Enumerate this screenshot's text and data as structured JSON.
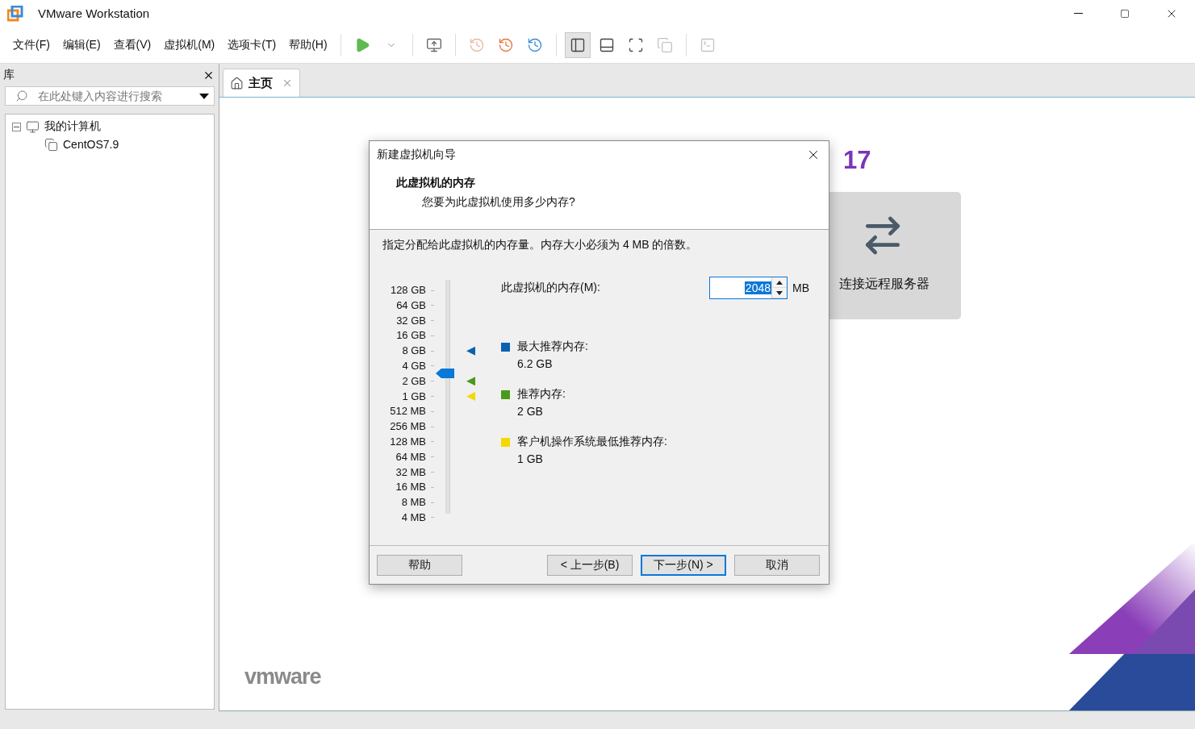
{
  "window": {
    "title": "VMware Workstation"
  },
  "menu": [
    "文件(F)",
    "编辑(E)",
    "查看(V)",
    "虚拟机(M)",
    "选项卡(T)",
    "帮助(H)"
  ],
  "toolbar": [
    {
      "kind": "play",
      "disabled": false,
      "selected": false
    },
    {
      "kind": "caret",
      "disabled": true,
      "selected": false
    },
    {
      "kind": "sep"
    },
    {
      "kind": "send",
      "disabled": false,
      "selected": false
    },
    {
      "kind": "sep"
    },
    {
      "kind": "snapshot",
      "disabled": true,
      "selected": false
    },
    {
      "kind": "revert",
      "disabled": false,
      "selected": false
    },
    {
      "kind": "manage",
      "disabled": false,
      "selected": false
    },
    {
      "kind": "sep"
    },
    {
      "kind": "sidebar",
      "disabled": false,
      "selected": true
    },
    {
      "kind": "bottompanel",
      "disabled": false,
      "selected": false
    },
    {
      "kind": "fullscreen",
      "disabled": false,
      "selected": false
    },
    {
      "kind": "unity",
      "disabled": true,
      "selected": false
    },
    {
      "kind": "sep"
    },
    {
      "kind": "console",
      "disabled": true,
      "selected": false
    }
  ],
  "library": {
    "title": "库",
    "search": {
      "placeholder": "在此处键入内容进行搜索"
    },
    "tree": [
      {
        "label": "我的计算机",
        "expanded": true,
        "children": [
          {
            "label": "CentOS7.9"
          }
        ]
      }
    ]
  },
  "tabs": [
    {
      "label": "主页",
      "selected": true
    }
  ],
  "home": {
    "version": "17",
    "card": {
      "label": "连接远程服务器"
    },
    "logo": "vmware"
  },
  "dialog": {
    "title": "新建虚拟机向导",
    "heading": "此虚拟机的内存",
    "subheading": "您要为此虚拟机使用多少内存?",
    "instruction": "指定分配给此虚拟机的内存量。内存大小必须为 4 MB 的倍数。",
    "scale": [
      {
        "label": "128 GB"
      },
      {
        "label": "64 GB"
      },
      {
        "label": "32 GB"
      },
      {
        "label": "16 GB"
      },
      {
        "label": "8 GB",
        "color": "#0a62b0"
      },
      {
        "label": "4 GB"
      },
      {
        "label": "2 GB",
        "color": "#4a9a1a"
      },
      {
        "label": "1 GB",
        "color": "#f5d800"
      },
      {
        "label": "512 MB"
      },
      {
        "label": "256 MB"
      },
      {
        "label": "128 MB"
      },
      {
        "label": "64 MB"
      },
      {
        "label": "32 MB"
      },
      {
        "label": "16 MB"
      },
      {
        "label": "8 MB"
      },
      {
        "label": "4 MB"
      }
    ],
    "slider": {
      "level": 0.6
    },
    "memory": {
      "label": "此虚拟机的内存(M):",
      "value": "2048",
      "unit": "MB"
    },
    "recommendations": [
      {
        "label": "最大推荐内存:",
        "value": "6.2 GB",
        "color": "#0a62b0"
      },
      {
        "label": "推荐内存:",
        "value": "2 GB",
        "color": "#4a9a1a"
      },
      {
        "label": "客户机操作系统最低推荐内存:",
        "value": "1 GB",
        "color": "#f5d800"
      }
    ],
    "buttons": [
      {
        "label": "帮助",
        "default": false
      },
      {
        "label": "< 上一步(B)",
        "default": false
      },
      {
        "label": "下一步(N) >",
        "default": true
      },
      {
        "label": "取消",
        "default": false
      }
    ]
  }
}
